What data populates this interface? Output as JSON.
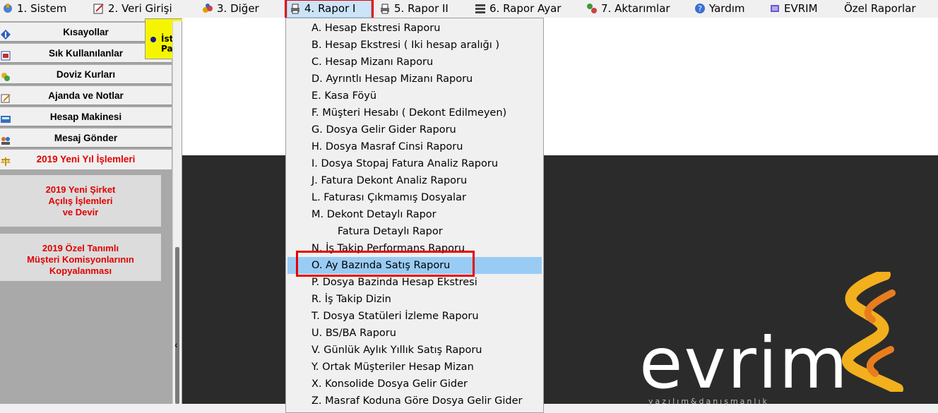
{
  "menubar": {
    "items": [
      {
        "label": "1.   Sistem",
        "icon": "system-icon"
      },
      {
        "label": "2.   Veri Girişi",
        "icon": "data-entry-icon"
      },
      {
        "label": "3.   Diğer",
        "icon": "other-icon"
      },
      {
        "label": "4.   Rapor I",
        "icon": "printer-icon"
      },
      {
        "label": "5.   Rapor II",
        "icon": "printer-icon"
      },
      {
        "label": "6.   Rapor Ayar",
        "icon": "report-settings-icon"
      },
      {
        "label": "7.   Aktarımlar",
        "icon": "transfer-icon"
      },
      {
        "label": "Yardım",
        "icon": "help-icon"
      },
      {
        "label": "EVRIM",
        "icon": "book-icon"
      },
      {
        "label": "Özel Raporlar",
        "icon": ""
      }
    ]
  },
  "sidebar": {
    "buttons": [
      {
        "label": "Kısayollar",
        "icon": "shortcut-icon"
      },
      {
        "label": "Sık Kullanılanlar",
        "icon": "favorites-icon"
      },
      {
        "label": "Doviz Kurları",
        "icon": "currency-icon"
      },
      {
        "label": "Ajanda ve Notlar",
        "icon": "notes-icon"
      },
      {
        "label": "Hesap Makinesi",
        "icon": "calculator-icon"
      },
      {
        "label": "Mesaj Gönder",
        "icon": "users-icon"
      },
      {
        "label": "2019 Yeni Yıl İşlemleri",
        "icon": "scales-icon"
      }
    ],
    "big_buttons": [
      {
        "line1": "2019 Yeni Şirket",
        "line2": "Açılış İşlemleri",
        "line3": "ve Devir"
      },
      {
        "line1": "2019 Özel Tanımlı",
        "line2": "Müşteri Komisyonlarının",
        "line3": "Kopyalanması"
      }
    ]
  },
  "tooltip": {
    "label": "İstenen Para"
  },
  "dropdown": {
    "items": [
      "A.   Hesap Ekstresi Raporu",
      "B.   Hesap Ekstresi ( Iki hesap aralığı )",
      "C.   Hesap Mizanı Raporu",
      "D.   Ayrıntlı Hesap Mizanı Raporu",
      "E.   Kasa Föyü",
      "F.   Müşteri Hesabı ( Dekont Edilmeyen)",
      "G.   Dosya Gelir Gider Raporu",
      "H.   Dosya Masraf Cinsi Raporu",
      "I.   Dosya Stopaj Fatura Analiz Raporu",
      "J.   Fatura Dekont Analiz Raporu",
      "L.   Faturası Çıkmamış Dosyalar",
      "M.   Dekont Detaylı Rapor",
      "        Fatura Detaylı Rapor",
      "N.   İş Takip Performans Raporu",
      "O.   Ay Bazında Satış Raporu",
      "P.   Dosya Bazinda Hesap Ekstresi",
      "R.   İş Takip Dizin",
      "T.   Dosya Statüleri İzleme Raporu",
      "U.   BS/BA Raporu",
      "V. Günlük Aylık Yıllık Satış Raporu",
      "Y. Ortak Müşteriler Hesap Mizan",
      "X. Konsolide Dosya Gelir Gider",
      "Z. Masraf Koduna Göre Dosya Gelir Gider"
    ],
    "selected_index": 14
  },
  "splitter": {
    "arrow": "‹"
  },
  "logo": {
    "text": "evrim",
    "subtitle": "yazılım&danışmanlık"
  },
  "colors": {
    "highlight_box": "#e60000",
    "selected_item": "#99ccf5",
    "tooltip_bg": "#f5f500",
    "red_text": "#e00000"
  }
}
